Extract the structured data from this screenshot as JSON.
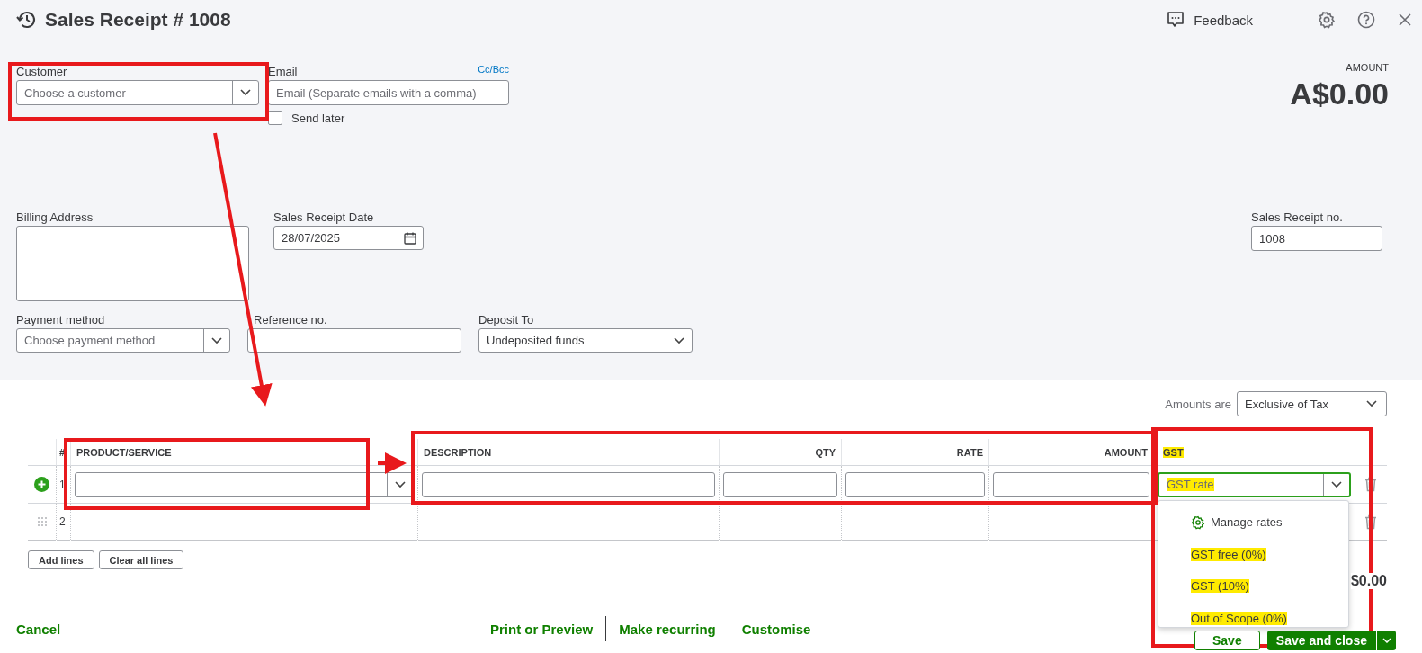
{
  "header": {
    "title": "Sales Receipt # 1008",
    "feedback": "Feedback"
  },
  "amount": {
    "label": "AMOUNT",
    "value": "A$0.00"
  },
  "customer": {
    "label": "Customer",
    "placeholder": "Choose a customer"
  },
  "email": {
    "label": "Email",
    "link": "Cc/Bcc",
    "placeholder": "Email (Separate emails with a comma)"
  },
  "send_later": {
    "label": "Send later",
    "checked": false
  },
  "billing_address": {
    "label": "Billing Address"
  },
  "sales_receipt_date": {
    "label": "Sales Receipt Date",
    "value": "28/07/2025"
  },
  "sales_receipt_no": {
    "label": "Sales Receipt no.",
    "value": "1008"
  },
  "payment_method": {
    "label": "Payment method",
    "placeholder": "Choose payment method"
  },
  "reference_no": {
    "label": "Reference no."
  },
  "deposit_to": {
    "label": "Deposit To",
    "value": "Undeposited funds"
  },
  "amounts_are": {
    "label": "Amounts are",
    "value": "Exclusive of Tax"
  },
  "table": {
    "columns": [
      {
        "label": "#",
        "highlighted": false
      },
      {
        "label": "PRODUCT/SERVICE",
        "highlighted": false
      },
      {
        "label": "DESCRIPTION",
        "highlighted": false
      },
      {
        "label": "QTY",
        "highlighted": false
      },
      {
        "label": "RATE",
        "highlighted": false
      },
      {
        "label": "AMOUNT",
        "highlighted": false
      },
      {
        "label": "GST",
        "highlighted": true
      }
    ],
    "rows": [
      {
        "number": "1",
        "kind": "edit"
      },
      {
        "number": "2",
        "kind": "empty"
      }
    ]
  },
  "gst_field": {
    "text": "GST rate",
    "highlighted": true
  },
  "gst_menu": {
    "items": [
      {
        "kind": "action",
        "label": "Manage rates",
        "highlighted": false
      },
      {
        "kind": "option",
        "label": "GST free (0%)",
        "highlighted": true
      },
      {
        "kind": "option",
        "label": "GST (10%)",
        "highlighted": true
      },
      {
        "kind": "option",
        "label": "Out of Scope (0%)",
        "highlighted": true
      }
    ]
  },
  "table_buttons": [
    "Add lines",
    "Clear all lines"
  ],
  "total": "$0.00",
  "footer": {
    "cancel": "Cancel",
    "links": [
      "Print or Preview",
      "Make recurring",
      "Customise"
    ],
    "save": "Save",
    "save_and_close": "Save and close"
  }
}
